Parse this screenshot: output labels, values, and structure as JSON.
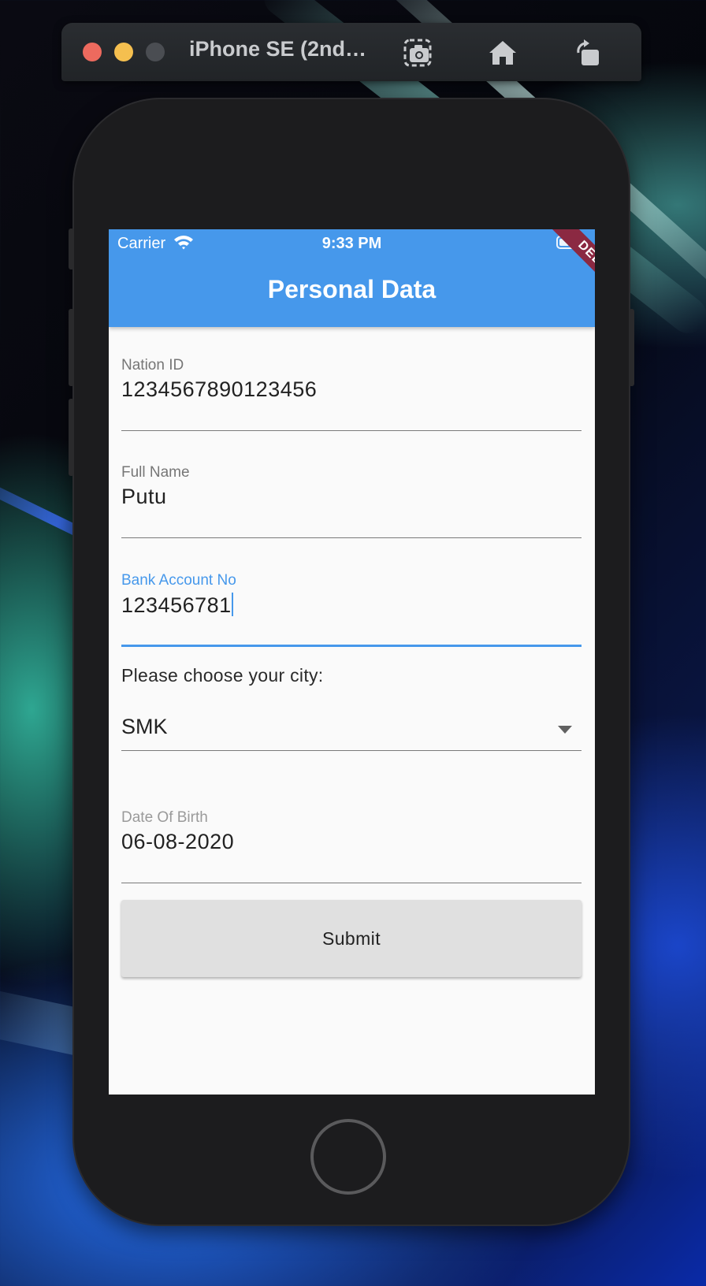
{
  "simulator": {
    "title": "iPhone SE (2nd…",
    "buttons": [
      {
        "icon": "screenshot-icon"
      },
      {
        "icon": "home-icon"
      },
      {
        "icon": "rotate-icon"
      }
    ]
  },
  "status_bar": {
    "carrier": "Carrier",
    "time": "9:33 PM"
  },
  "app_bar": {
    "title": "Personal Data",
    "debug_banner": "DEBUG",
    "color": "#4698eb"
  },
  "form": {
    "nation_id": {
      "label": "Nation ID",
      "value": "1234567890123456"
    },
    "full_name": {
      "label": "Full Name",
      "value": "Putu"
    },
    "bank_account": {
      "label": "Bank Account No",
      "value": "123456781",
      "focused": true
    },
    "city": {
      "prompt": "Please choose your city:",
      "selected": "SMK"
    },
    "dob": {
      "label": "Date Of Birth",
      "value": "06-08-2020"
    },
    "submit_label": "Submit"
  }
}
